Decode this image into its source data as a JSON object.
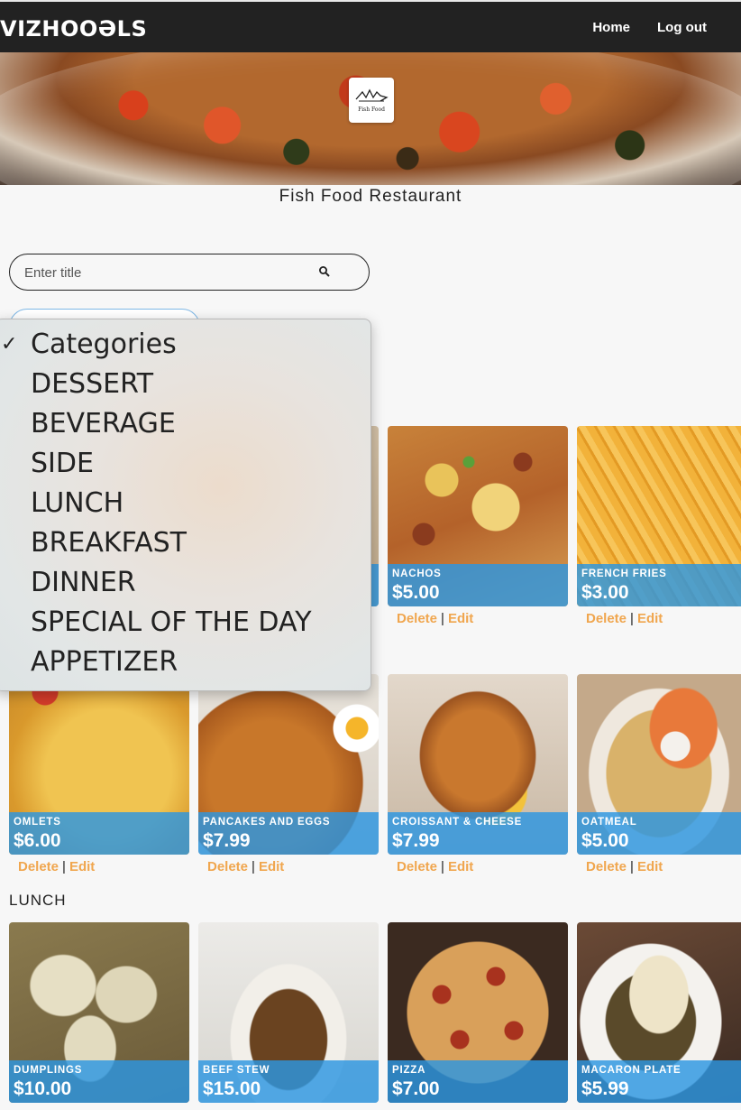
{
  "header": {
    "logo": "VIZHOOƏLS",
    "nav": [
      {
        "label": "Home"
      },
      {
        "label": "Log out"
      }
    ]
  },
  "restaurant": {
    "name": "Fish Food Restaurant",
    "logo_text": "Fish Food"
  },
  "search": {
    "placeholder": "Enter title",
    "value": ""
  },
  "category_dropdown": {
    "selected": "Categories",
    "options": [
      "Categories",
      "DESSERT",
      "BEVERAGE",
      "SIDE",
      "LUNCH",
      "BREAKFAST",
      "DINNER",
      "SPECIAL OF THE DAY",
      "APPETIZER"
    ]
  },
  "actions": {
    "delete": "Delete",
    "edit": "Edit",
    "sep": "|"
  },
  "sections": [
    {
      "title": "",
      "items": [
        {
          "name": "NACHOS",
          "price": "$5.00"
        },
        {
          "name": "FRENCH FRIES",
          "price": "$3.00"
        }
      ]
    },
    {
      "title": "",
      "items": [
        {
          "name": "OMLETS",
          "price": "$6.00"
        },
        {
          "name": "PANCAKES AND EGGS",
          "price": "$7.99"
        },
        {
          "name": "CROISSANT & CHEESE",
          "price": "$7.99"
        },
        {
          "name": "OATMEAL",
          "price": "$5.00"
        }
      ]
    },
    {
      "title": "LUNCH",
      "items": [
        {
          "name": "DUMPLINGS",
          "price": "$10.00"
        },
        {
          "name": "BEEF STEW",
          "price": "$15.00"
        },
        {
          "name": "PIZZA",
          "price": "$7.00"
        },
        {
          "name": "MACARON PLATE",
          "price": "$5.99"
        }
      ]
    }
  ],
  "colors": {
    "header_bg": "#222222",
    "card_band": "#2c96e2",
    "action_link": "#f0a64e"
  }
}
